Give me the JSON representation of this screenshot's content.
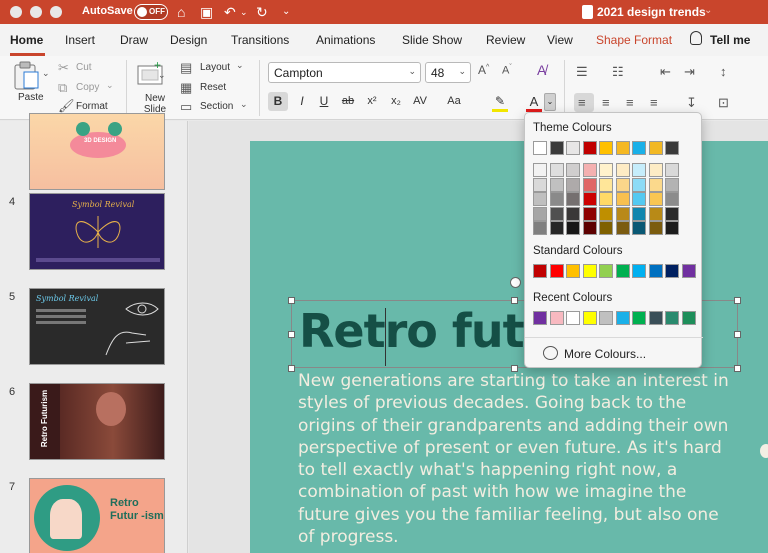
{
  "titlebar": {
    "autosave_label": "AutoSave",
    "autosave_state": "OFF",
    "document_title": "2021 design trends"
  },
  "tabs": [
    "Home",
    "Insert",
    "Draw",
    "Design",
    "Transitions",
    "Animations",
    "Slide Show",
    "Review",
    "View",
    "Shape Format",
    "Tell me"
  ],
  "ribbon": {
    "paste": "Paste",
    "cut": "Cut",
    "copy": "Copy",
    "format": "Format",
    "new_slide": "New Slide",
    "layout": "Layout",
    "reset": "Reset",
    "section": "Section",
    "font": "Campton",
    "size": "48"
  },
  "slides": [
    {
      "num": "",
      "title": "3D DESIGN"
    },
    {
      "num": "4",
      "title": "Symbol Revival"
    },
    {
      "num": "5",
      "title": "Symbol Revival"
    },
    {
      "num": "6",
      "title": "Retro Futurism"
    },
    {
      "num": "7",
      "title": "Retro Futur -ism"
    }
  ],
  "slide": {
    "headline": "Retro futurism",
    "body": "New generations are starting to take an interest in styles of previous decades. Going back to the origins of their grandparents and adding their own perspective of present or even future. As it's hard to tell exactly what's happening right now, a combination of past with how we imagine the future gives you the familiar feeling, but also one of progress."
  },
  "color_menu": {
    "theme_label": "Theme Colours",
    "standard_label": "Standard Colours",
    "recent_label": "Recent Colours",
    "more_label": "More Colours...",
    "theme_top": [
      "#ffffff",
      "#3a3a3a",
      "#e7e6e6",
      "#c00000",
      "#ffc000",
      "#f5b822",
      "#1ab0e8",
      "#f2b824",
      "#3a3a3a"
    ],
    "theme_shades": [
      [
        "#f2f2f2",
        "#d9d9d9",
        "#bfbfbf",
        "#a6a6a6",
        "#7f7f7f"
      ],
      [
        "#dedede",
        "#c0c0c0",
        "#8a8a8a",
        "#505050",
        "#262626"
      ],
      [
        "#d0cece",
        "#aeaaaa",
        "#757070",
        "#3a3838",
        "#171616"
      ],
      [
        "#f4b0b0",
        "#e06666",
        "#cc0000",
        "#8e0000",
        "#5c0000"
      ],
      [
        "#fff2cc",
        "#ffe699",
        "#ffd966",
        "#bf8f00",
        "#7f6000"
      ],
      [
        "#fdebc4",
        "#fbd68a",
        "#f8c04f",
        "#b98919",
        "#7b5b10"
      ],
      [
        "#c6edfb",
        "#8ddbf6",
        "#54c9f1",
        "#0f85ae",
        "#0a5874"
      ],
      [
        "#fdecc5",
        "#fbd98c",
        "#f9c652",
        "#b88a17",
        "#7b5c0f"
      ],
      [
        "#d9d9d9",
        "#b3b3b3",
        "#8c8c8c",
        "#2b2b2b",
        "#1c1c1c"
      ]
    ],
    "standard": [
      "#c00000",
      "#ff0000",
      "#ffc000",
      "#ffff00",
      "#92d050",
      "#00b050",
      "#00b0f0",
      "#0070c0",
      "#002060",
      "#7030a0"
    ],
    "recent": [
      "#7030a0",
      "#f8b9c0",
      "#ffffff",
      "#ffff00",
      "#c0c0c0",
      "#1ab0e8",
      "#00b050",
      "#3a4f58",
      "#2a8a6e",
      "#1e8e5a"
    ]
  }
}
